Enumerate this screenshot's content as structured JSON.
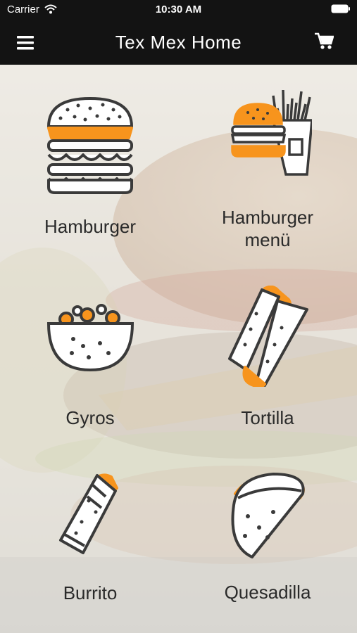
{
  "status": {
    "carrier": "Carrier",
    "time": "10:30 AM"
  },
  "header": {
    "title": "Tex Mex Home"
  },
  "tiles": [
    {
      "label": "Hamburger"
    },
    {
      "label": "Hamburger\nmenü"
    },
    {
      "label": "Gyros"
    },
    {
      "label": "Tortilla"
    },
    {
      "label": "Burrito"
    },
    {
      "label": "Quesadilla"
    }
  ],
  "icons": {
    "menu": "hamburger-menu-icon",
    "cart": "cart-icon",
    "wifi": "wifi-icon",
    "battery": "battery-icon"
  },
  "colors": {
    "accent": "#f7941d",
    "line": "#3a3a3a",
    "bar": "#131313"
  }
}
